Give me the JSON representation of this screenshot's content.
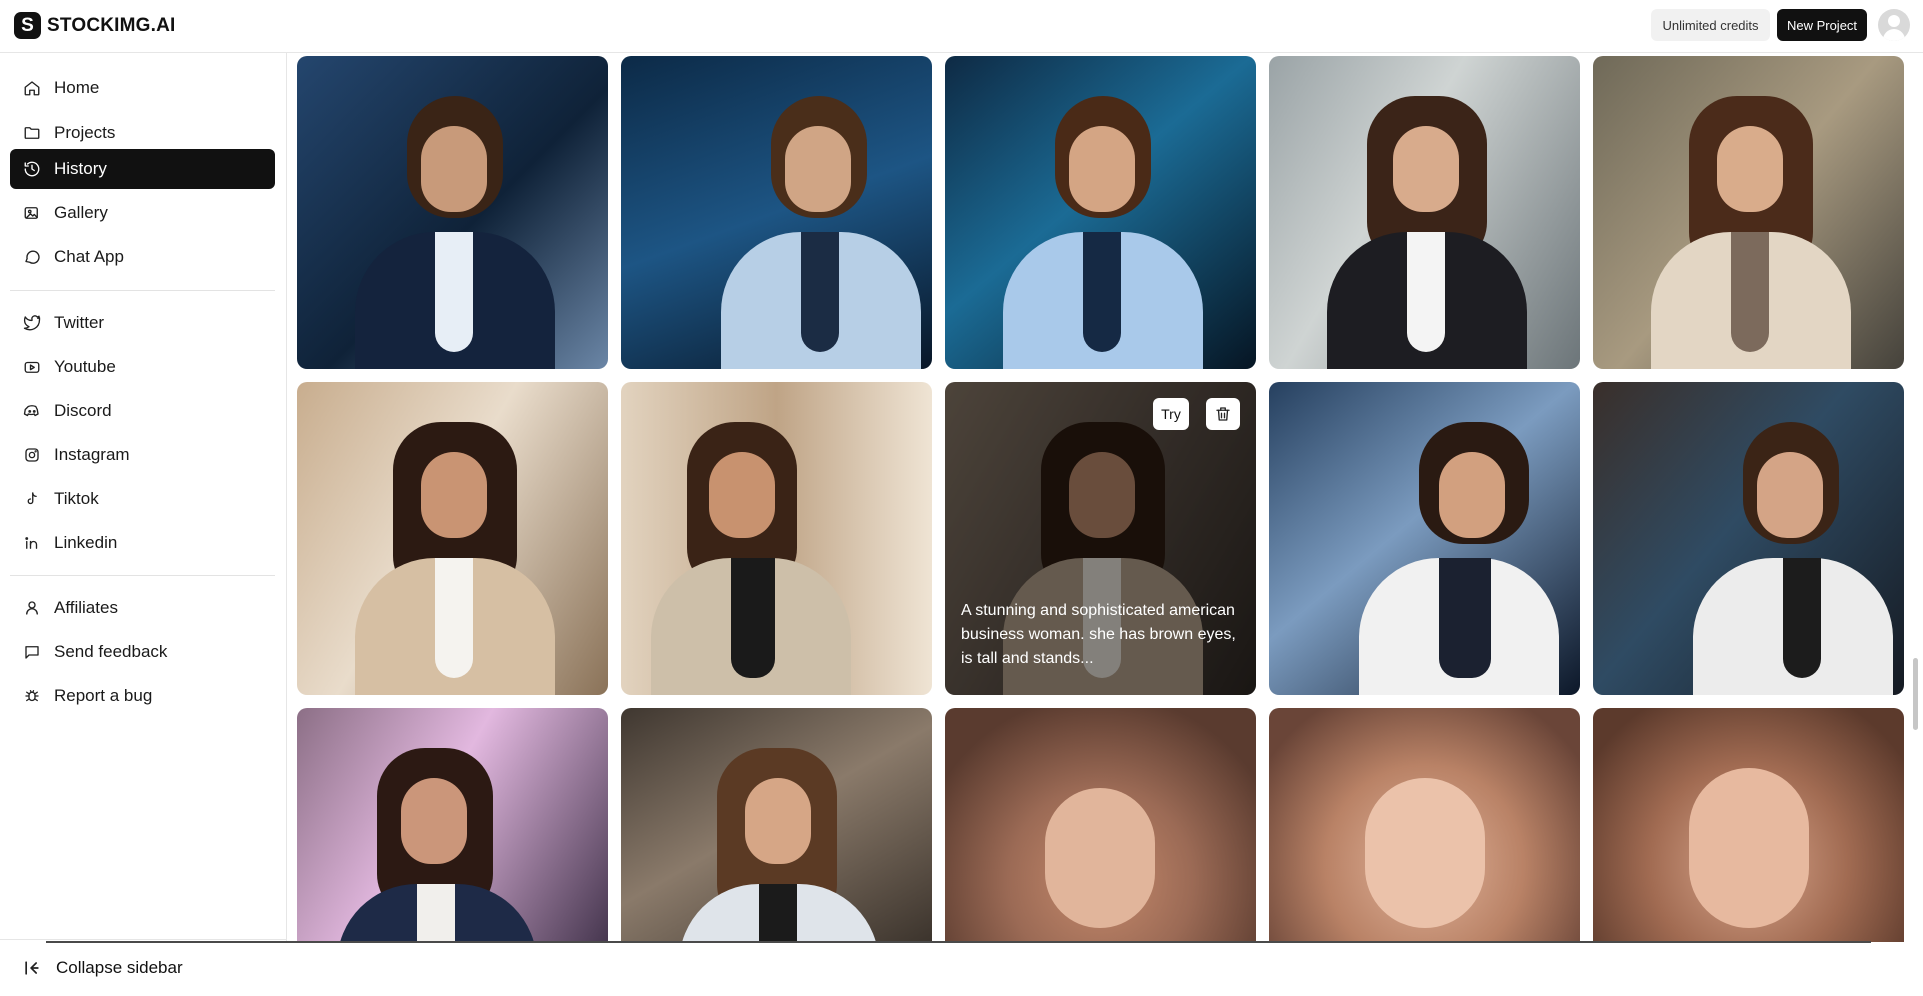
{
  "brand": {
    "logo_letter": "S",
    "name": "STOCKIMG.AI"
  },
  "header": {
    "credits_label": "Unlimited credits",
    "new_project_label": "New Project"
  },
  "sidebar": {
    "main_items": [
      {
        "label": "Home",
        "icon": "home-icon"
      },
      {
        "label": "Projects",
        "icon": "folder-icon"
      },
      {
        "label": "History",
        "icon": "history-icon",
        "active": true
      },
      {
        "label": "Gallery",
        "icon": "gallery-icon"
      },
      {
        "label": "Chat App",
        "icon": "chat-icon"
      }
    ],
    "social_items": [
      {
        "label": "Twitter",
        "icon": "twitter-icon"
      },
      {
        "label": "Youtube",
        "icon": "youtube-icon"
      },
      {
        "label": "Discord",
        "icon": "discord-icon"
      },
      {
        "label": "Instagram",
        "icon": "instagram-icon"
      },
      {
        "label": "Tiktok",
        "icon": "tiktok-icon"
      },
      {
        "label": "Linkedin",
        "icon": "linkedin-icon"
      }
    ],
    "support_items": [
      {
        "label": "Affiliates",
        "icon": "user-icon"
      },
      {
        "label": "Send feedback",
        "icon": "message-icon"
      },
      {
        "label": "Report a bug",
        "icon": "bug-icon"
      }
    ],
    "collapse_label": "Collapse sidebar"
  },
  "hover_card": {
    "try_label": "Try",
    "caption": "A stunning and sophisticated american business woman. she has brown eyes, is tall and stands..."
  },
  "colors": {
    "accent": "#111111",
    "active_bg": "#111111"
  }
}
